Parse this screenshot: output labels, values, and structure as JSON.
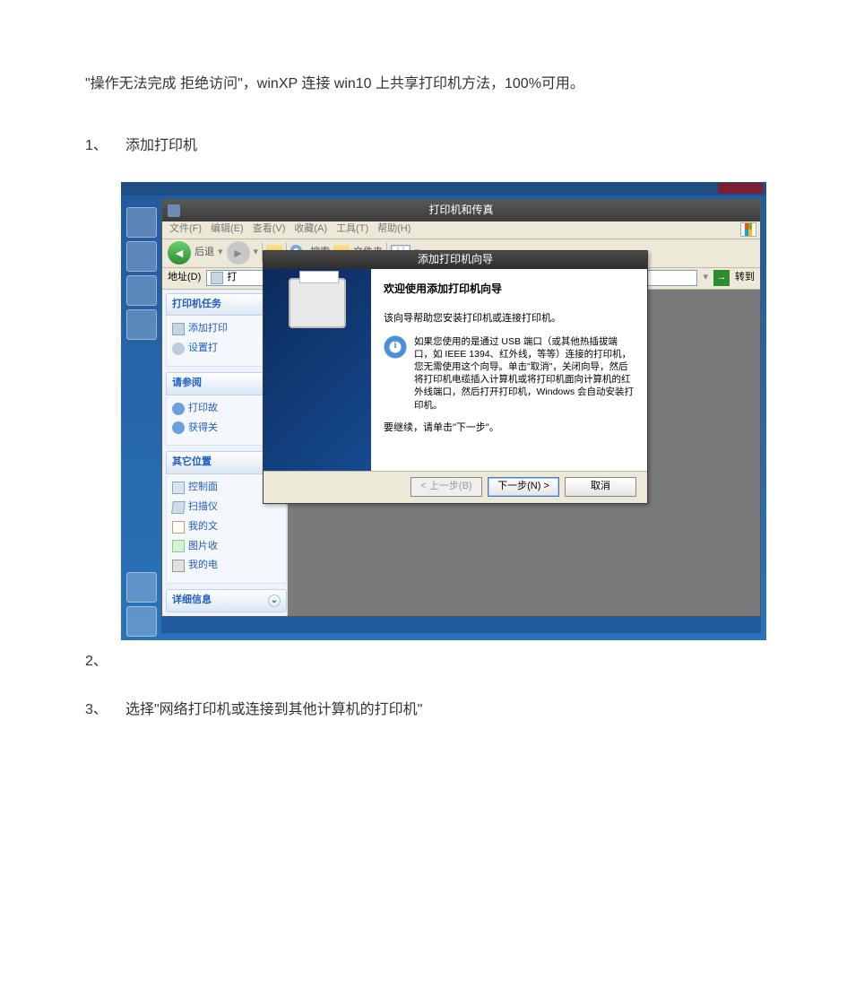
{
  "doc": {
    "intro": "\"操作无法完成 拒绝访问\"，winXP 连接 win10 上共享打印机方法，100%可用。",
    "step1_num": "1、",
    "step1_text": "添加打印机",
    "step2_num": "2、",
    "step3_num": "3、",
    "step3_text": "选择\"网络打印机或连接到其他计算机的打印机\""
  },
  "explorer": {
    "title": "打印机和传真",
    "menu": {
      "file": "文件(F)",
      "edit": "编辑(E)",
      "view": "查看(V)",
      "fav": "收藏(A)",
      "tools": "工具(T)",
      "help": "帮助(H)"
    },
    "toolbar": {
      "back": "后退",
      "search": "搜索",
      "folders": "文件夹"
    },
    "addr": {
      "label": "地址(D)",
      "value": "打",
      "go": "转到"
    },
    "panels": {
      "tasks_h": "打印机任务",
      "tasks": {
        "add": "添加打印",
        "setup": "设置打"
      },
      "see_h": "请参阅",
      "see": {
        "trouble": "打印故",
        "help": "获得关"
      },
      "other_h": "其它位置",
      "other": {
        "cp": "控制面",
        "scan": "扫描仪",
        "mydoc": "我的文",
        "mypic": "图片收",
        "mycomp": "我的电"
      },
      "details_h": "详细信息"
    }
  },
  "wizard": {
    "title": "添加打印机向导",
    "heading": "欢迎使用添加打印机向导",
    "line1": "该向导帮助您安装打印机或连接打印机。",
    "info": "如果您使用的是通过 USB 端口（或其他热插拔端口，如 IEEE 1394、红外线，等等）连接的打印机，您无需使用这个向导。单击\"取消\"，关闭向导，然后将打印机电缆插入计算机或将打印机面向计算机的红外线端口，然后打开打印机，Windows 会自动安装打印机。",
    "line2": "要继续，请单击\"下一步\"。",
    "btn_back": "< 上一步(B)",
    "btn_next": "下一步(N) >",
    "btn_cancel": "取消"
  }
}
